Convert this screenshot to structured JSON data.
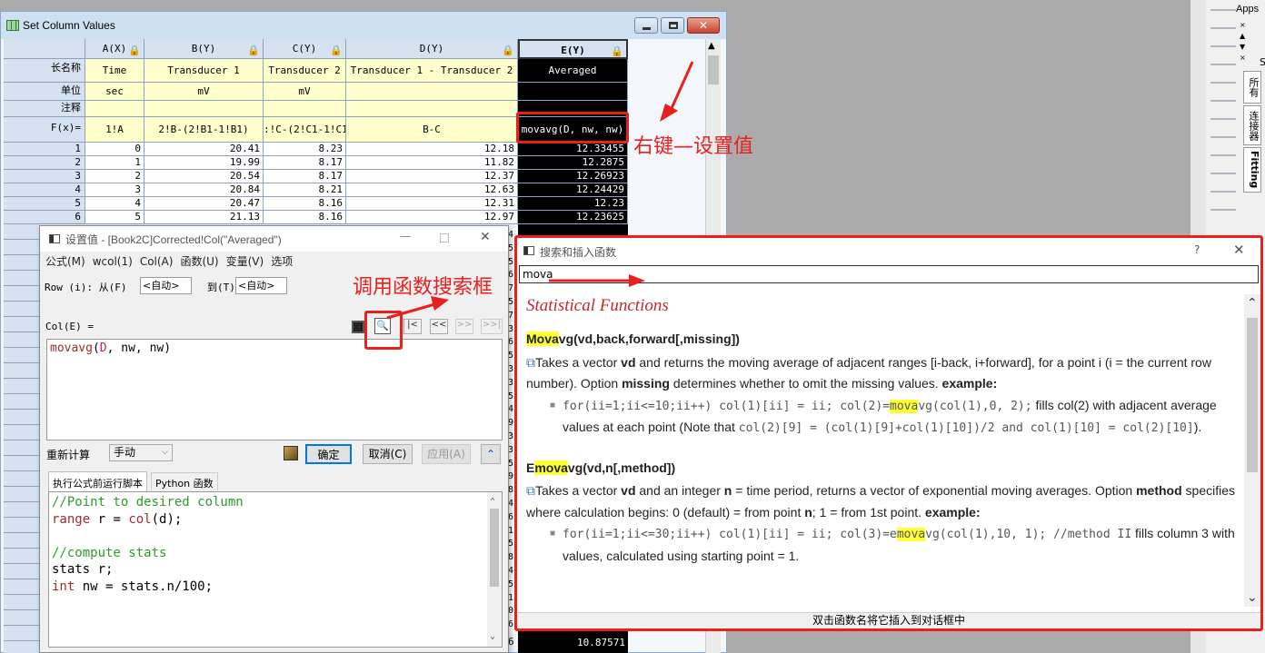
{
  "spreadsheet": {
    "title": "Set Column Values",
    "columns": [
      {
        "header": "A(X)",
        "long_name": "Time",
        "unit": "sec",
        "comment": "",
        "formula": "1!A"
      },
      {
        "header": "B(Y)",
        "long_name": "Transducer 1",
        "unit": "mV",
        "comment": "",
        "formula": "2!B-(2!B1-1!B1)"
      },
      {
        "header": "C(Y)",
        "long_name": "Transducer 2",
        "unit": "mV",
        "comment": "",
        "formula": ":!C-(2!C1-1!C1)"
      },
      {
        "header": "D(Y)",
        "long_name": "Transducer 1 - Transducer 2",
        "unit": "",
        "comment": "",
        "formula": "B-C"
      },
      {
        "header": "E(Y)",
        "long_name": "Averaged",
        "unit": "",
        "comment": "",
        "formula": "movavg(D, nw, nw)"
      }
    ],
    "row_labels": {
      "long_name": "长名称",
      "unit": "单位",
      "comment": "注释",
      "formula": "F(x)="
    },
    "rows": [
      [
        "1",
        "0",
        "20.41",
        "8.23",
        "12.18",
        "12.33455"
      ],
      [
        "2",
        "1",
        "19.99",
        "8.17",
        "11.82",
        "12.2875"
      ],
      [
        "3",
        "2",
        "20.54",
        "8.17",
        "12.37",
        "12.26923"
      ],
      [
        "4",
        "3",
        "20.84",
        "8.21",
        "12.63",
        "12.24429"
      ],
      [
        "5",
        "4",
        "20.47",
        "8.16",
        "12.31",
        "12.23"
      ],
      [
        "6",
        "5",
        "21.13",
        "8.16",
        "12.97",
        "12.23625"
      ]
    ],
    "bottom_row": {
      "label": "6",
      "e_value": "10.87571"
    },
    "right_edge_digits": [
      "4",
      "5",
      "5",
      "6",
      "7",
      "5",
      "7",
      "3",
      "6",
      "5",
      "3",
      "3",
      "5",
      "4",
      "9",
      "3",
      "3",
      "5",
      "9",
      "8",
      "4",
      "6",
      "1",
      "5",
      "8",
      "4",
      "5",
      "1",
      "0",
      "6"
    ]
  },
  "annotations": {
    "right_click": "右键—设置值",
    "call_search": "调用函数搜索框"
  },
  "set_values_dialog": {
    "title": "设置值 - [Book2C]Corrected!Col(\"Averaged\")",
    "menu": [
      "公式(M)",
      "wcol(1)",
      "Col(A)",
      "函数(U)",
      "变量(V)",
      "选项"
    ],
    "row_label": "Row (i): 从(F)",
    "from_value": "<自动>",
    "to_label": "到(T)",
    "to_value": "<自动>",
    "col_label": "Col(E) =",
    "formula_fn": "movavg",
    "formula_open": "(",
    "formula_arg1": "D",
    "formula_rest": ", nw, nw)",
    "recalc_label": "重新计算",
    "recalc_value": "手动",
    "ok": "确定",
    "cancel": "取消(C)",
    "apply": "应用(A)",
    "tabs": [
      "执行公式前运行脚本",
      "Python 函数"
    ],
    "script": {
      "c1": "//Point to desired column",
      "kw_range": "range",
      "range_mid": " r = ",
      "col_fn": "col",
      "col_args": "(d);",
      "c2": "//compute stats",
      "stats_line": "stats r;",
      "kw_int": "int",
      "int_rest": " nw = stats.n/100;"
    }
  },
  "search_dialog": {
    "title": "搜索和插入函数",
    "help": "?",
    "query": "mova",
    "section": "Statistical Functions",
    "f1_hl": "Mova",
    "f1_rest": "vg(vd,back,forward[,missing])",
    "f1_desc_a": "Takes a vector ",
    "f1_desc_vd": "vd",
    "f1_desc_b": " and returns the moving average of adjacent ranges [i-back, i+forward], for a point i (i = the current row number). Option ",
    "f1_desc_missing": "missing",
    "f1_desc_c": " determines whether to omit the missing values. ",
    "f1_example": "example:",
    "f1_code_a": "for(ii=1;ii<=10;ii++) col(1)[ii] = ii; col(2)=",
    "f1_code_hl": "mova",
    "f1_code_b": "vg(col(1),0, 2);",
    "f1_tail_a": " fills col(2) with adjacent average values at each point (Note that ",
    "f1_tail_code": "col(2)[9] = (col(1)[9]+col(1)[10])/2 and col(1)[10] = col(2)[10]",
    "f1_tail_b": ").",
    "f2_pre": "E",
    "f2_hl": "mova",
    "f2_rest": "vg(vd,n[,method])",
    "f2_desc_a": "Takes a vector ",
    "f2_desc_vd": "vd",
    "f2_desc_b": " and an integer ",
    "f2_desc_n": "n",
    "f2_desc_c": " = time period, returns a vector of exponential moving averages. Option ",
    "f2_desc_method": "method",
    "f2_desc_d": " specifies where calculation begins: 0 (default) = from point ",
    "f2_desc_n2": "n",
    "f2_desc_e": "; 1 = from 1st point. ",
    "f2_example": "example:",
    "f2_code_a": "for(ii=1;ii<=30;ii++) col(1)[ii] = ii; col(3)=e",
    "f2_code_hl": "mova",
    "f2_code_b": "vg(col(1),10, 1); //method II",
    "f2_tail": " fills column 3 with values, calculated using starting point = 1.",
    "status": "双击函数名将它插入到对话框中"
  },
  "right_panel": {
    "apps": "Apps",
    "tabs": [
      "所有",
      "连接器",
      "Fitting"
    ],
    "letter_s": "S"
  }
}
